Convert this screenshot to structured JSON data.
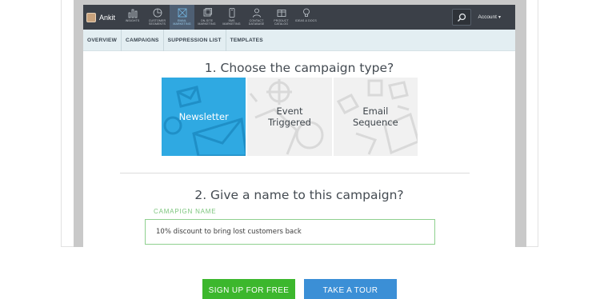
{
  "topnav": {
    "user": "Ankit",
    "items": [
      {
        "label": "INSIGHTS",
        "icon": "bar-chart-icon"
      },
      {
        "label": "CUSTOMER SEGMENTS",
        "icon": "pie-chart-icon"
      },
      {
        "label": "EMAIL MARKETING",
        "icon": "envelope-icon",
        "active": true
      },
      {
        "label": "ON-SITE MARKETING",
        "icon": "window-icon"
      },
      {
        "label": "SMS MARKETING",
        "icon": "phone-icon"
      },
      {
        "label": "CONTACT DATABASE",
        "icon": "person-icon"
      },
      {
        "label": "PRODUCT CATALOG",
        "icon": "catalog-icon"
      },
      {
        "label": "IDEAS & DOCS",
        "icon": "lightbulb-icon"
      }
    ],
    "account": "Account"
  },
  "subnav": [
    "OVERVIEW",
    "CAMPAIGNS",
    "SUPPRESSION LIST",
    "TEMPLATES"
  ],
  "step1": {
    "title": "1. Choose the campaign type?",
    "cards": [
      {
        "label": "Newsletter",
        "selected": true
      },
      {
        "label": "Event Triggered",
        "selected": false
      },
      {
        "label": "Email Sequence",
        "selected": false
      }
    ]
  },
  "step2": {
    "title": "2. Give a name to this campaign?",
    "field_label": "CAMAPIGN NAME",
    "field_value": "10% discount to bring lost customers back"
  },
  "cta": {
    "signup": "SIGN UP FOR FREE",
    "tour": "TAKE A TOUR"
  },
  "colors": {
    "nav_bg": "#3b4048",
    "accent_blue": "#2fa9e2",
    "signup_green": "#3cb72d",
    "tour_blue": "#3b8fd6",
    "field_green": "#8fd08f"
  }
}
